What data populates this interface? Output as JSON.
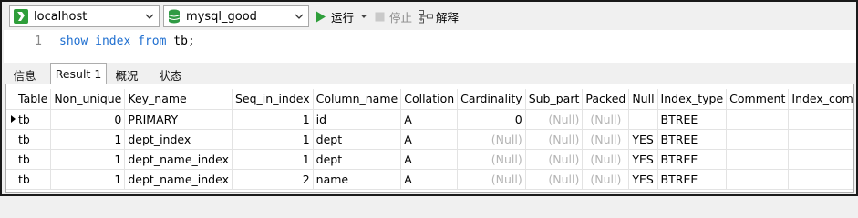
{
  "toolbar": {
    "connection": "localhost",
    "database": "mysql_good",
    "run_label": "运行",
    "stop_label": "停止",
    "explain_label": "解释"
  },
  "editor": {
    "line_number": "1",
    "tokens": [
      {
        "text": "show",
        "kind": "keyword"
      },
      {
        "text": " ",
        "kind": "space"
      },
      {
        "text": "index",
        "kind": "keyword"
      },
      {
        "text": " ",
        "kind": "space"
      },
      {
        "text": "from",
        "kind": "keyword"
      },
      {
        "text": " tb;",
        "kind": "ident"
      }
    ]
  },
  "tabs": [
    "信息",
    "Result 1",
    "概况",
    "状态"
  ],
  "active_tab": "Result 1",
  "result": {
    "columns": [
      "Table",
      "Non_unique",
      "Key_name",
      "Seq_in_index",
      "Column_name",
      "Collation",
      "Cardinality",
      "Sub_part",
      "Packed",
      "Null",
      "Index_type",
      "Comment",
      "Index_comment"
    ],
    "rows": [
      [
        "tb",
        "0",
        "PRIMARY",
        "1",
        "id",
        "A",
        "0",
        "(Null)",
        "(Null)",
        "",
        "BTREE",
        "",
        ""
      ],
      [
        "tb",
        "1",
        "dept_index",
        "1",
        "dept",
        "A",
        "(Null)",
        "(Null)",
        "(Null)",
        "YES",
        "BTREE",
        "",
        ""
      ],
      [
        "tb",
        "1",
        "dept_name_index",
        "1",
        "dept",
        "A",
        "(Null)",
        "(Null)",
        "(Null)",
        "YES",
        "BTREE",
        "",
        ""
      ],
      [
        "tb",
        "1",
        "dept_name_index",
        "2",
        "name",
        "A",
        "(Null)",
        "(Null)",
        "(Null)",
        "YES",
        "BTREE",
        "",
        ""
      ]
    ],
    "current_row": 0
  },
  "colors": {
    "keyword": "#1f6fd0",
    "null_text": "#b4b4b4",
    "run_green": "#2e9e3a",
    "db_green": "#2f9b44"
  }
}
